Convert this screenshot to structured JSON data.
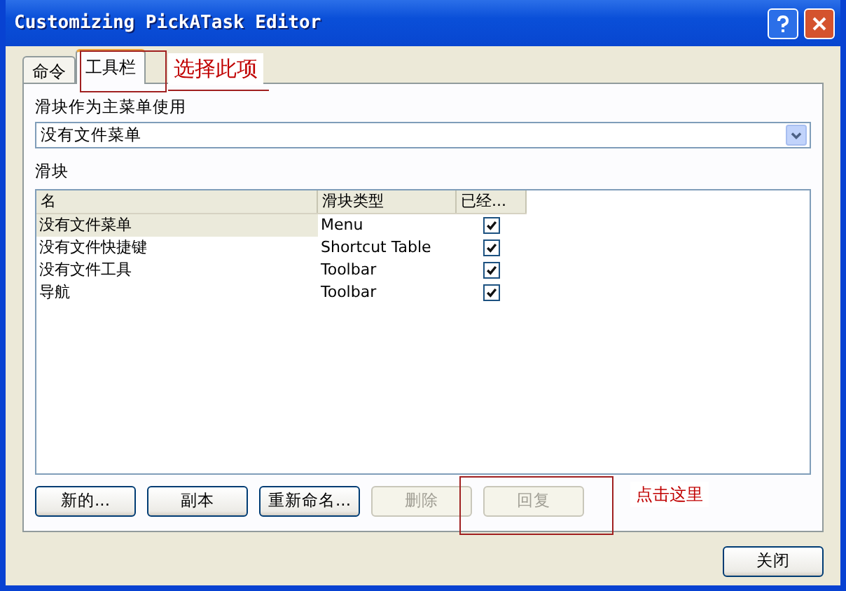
{
  "window": {
    "title": "Customizing PickATask Editor"
  },
  "tabs": [
    {
      "label": "命令",
      "selected": false
    },
    {
      "label": "工具栏",
      "selected": true
    }
  ],
  "main_menu": {
    "label": "滑块作为主菜单使用",
    "value": "没有文件菜单"
  },
  "list": {
    "label": "滑块",
    "columns": [
      "名",
      "滑块类型",
      "已经..."
    ],
    "rows": [
      {
        "name": "没有文件菜单",
        "type": "Menu",
        "checked": true,
        "selected": true
      },
      {
        "name": "没有文件快捷键",
        "type": "Shortcut Table",
        "checked": true,
        "selected": false
      },
      {
        "name": "没有文件工具",
        "type": "Toolbar",
        "checked": true,
        "selected": false
      },
      {
        "name": "导航",
        "type": "Toolbar",
        "checked": true,
        "selected": false
      }
    ]
  },
  "buttons": [
    {
      "label": "新的...",
      "disabled": false
    },
    {
      "label": "副本",
      "disabled": false
    },
    {
      "label": "重新命名...",
      "disabled": false
    },
    {
      "label": "删除",
      "disabled": true
    },
    {
      "label": "回复",
      "disabled": true
    }
  ],
  "close_button": {
    "label": "关闭"
  },
  "annotations": [
    {
      "kind": "tab-note",
      "text": "选择此项"
    },
    {
      "kind": "button-note",
      "text": "点击这里"
    }
  ]
}
